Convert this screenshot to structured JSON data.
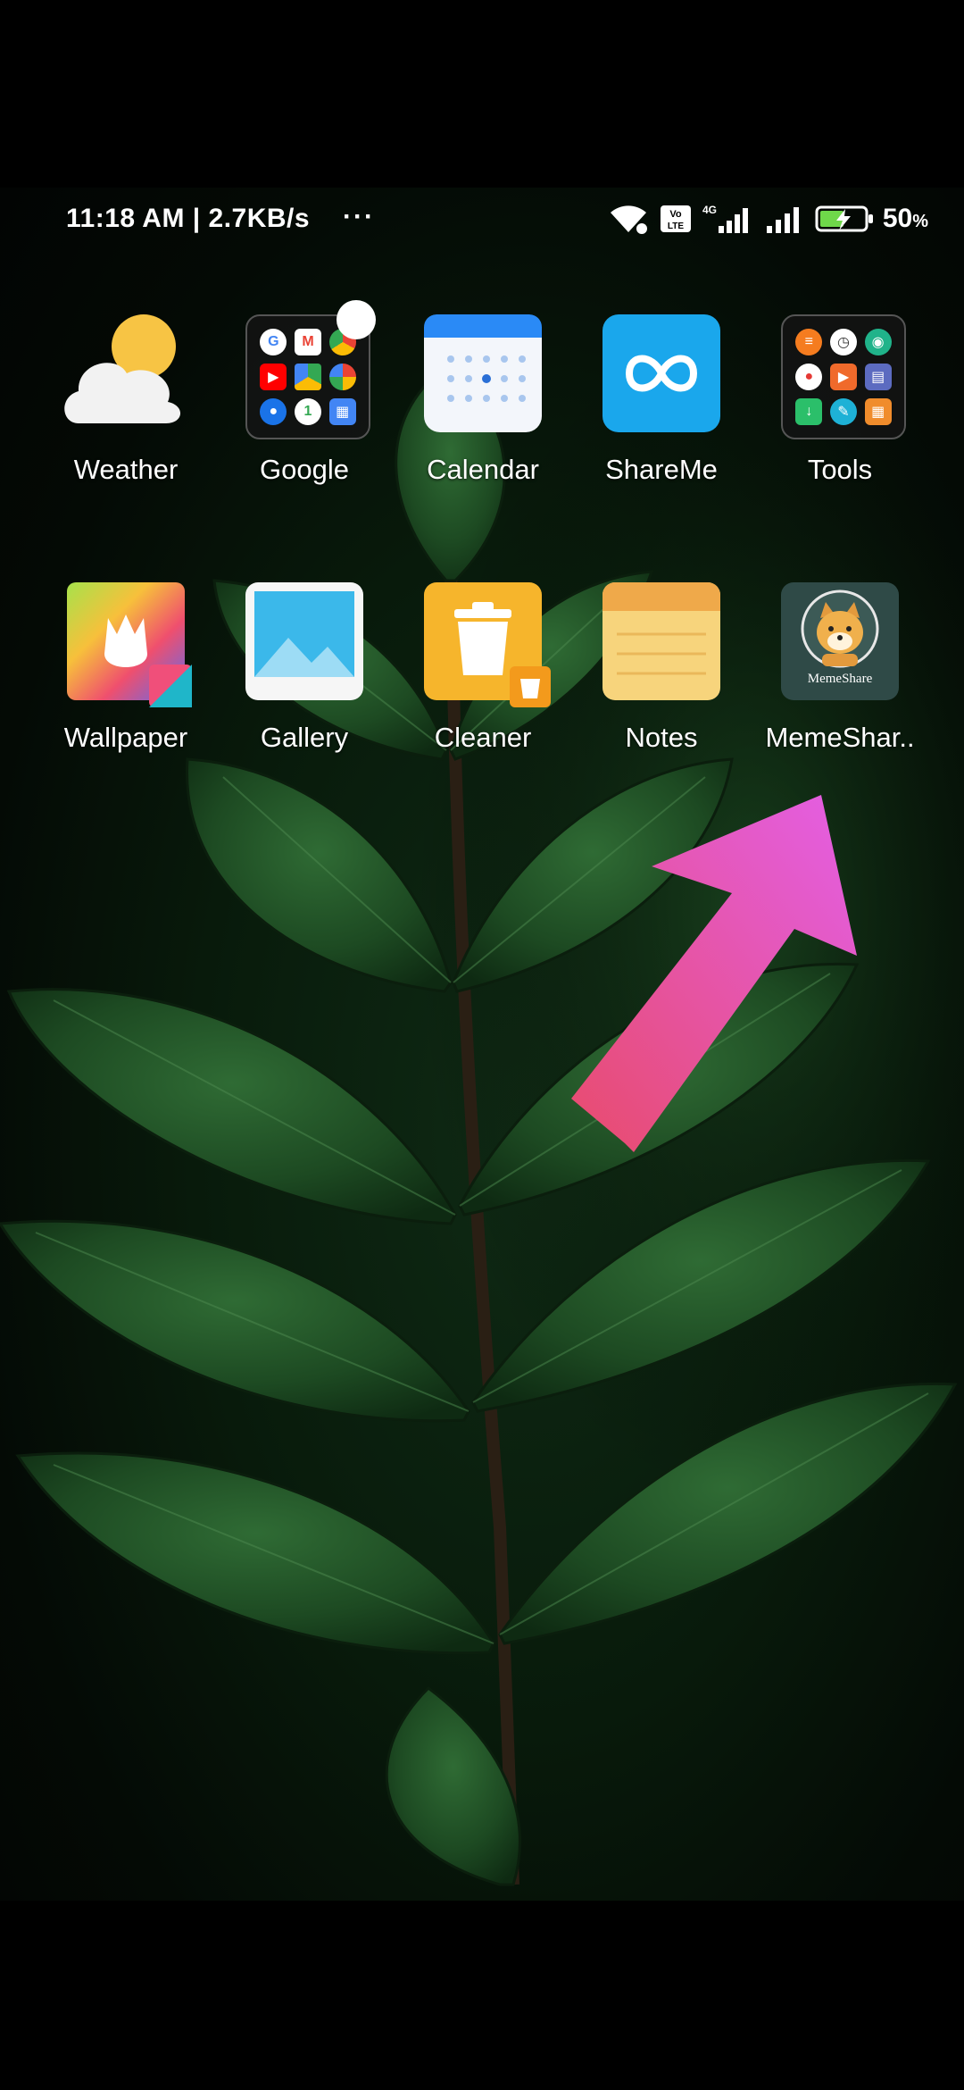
{
  "status_bar": {
    "time_speed": "11:18 AM | 2.7KB/s",
    "more": "···",
    "volte": "Vo LTE",
    "network": "4G",
    "battery_percent": "50",
    "battery_unit": "%"
  },
  "apps": [
    {
      "label": "Weather",
      "icon": "weather-icon"
    },
    {
      "label": "Google",
      "icon": "google-folder-icon"
    },
    {
      "label": "Calendar",
      "icon": "calendar-icon"
    },
    {
      "label": "ShareMe",
      "icon": "shareme-icon"
    },
    {
      "label": "Tools",
      "icon": "tools-folder-icon"
    },
    {
      "label": "Wallpaper",
      "icon": "wallpaper-icon"
    },
    {
      "label": "Gallery",
      "icon": "gallery-icon"
    },
    {
      "label": "Cleaner",
      "icon": "cleaner-icon"
    },
    {
      "label": "Notes",
      "icon": "notes-icon"
    },
    {
      "label": "MemeShar..",
      "icon": "memeshare-icon",
      "icon_text": "MemeShare"
    }
  ],
  "colors": {
    "arrow": "#e85fd6",
    "shareme": "#1aa7ec",
    "cleaner": "#f6b52c",
    "notes": "#f2c35e"
  }
}
